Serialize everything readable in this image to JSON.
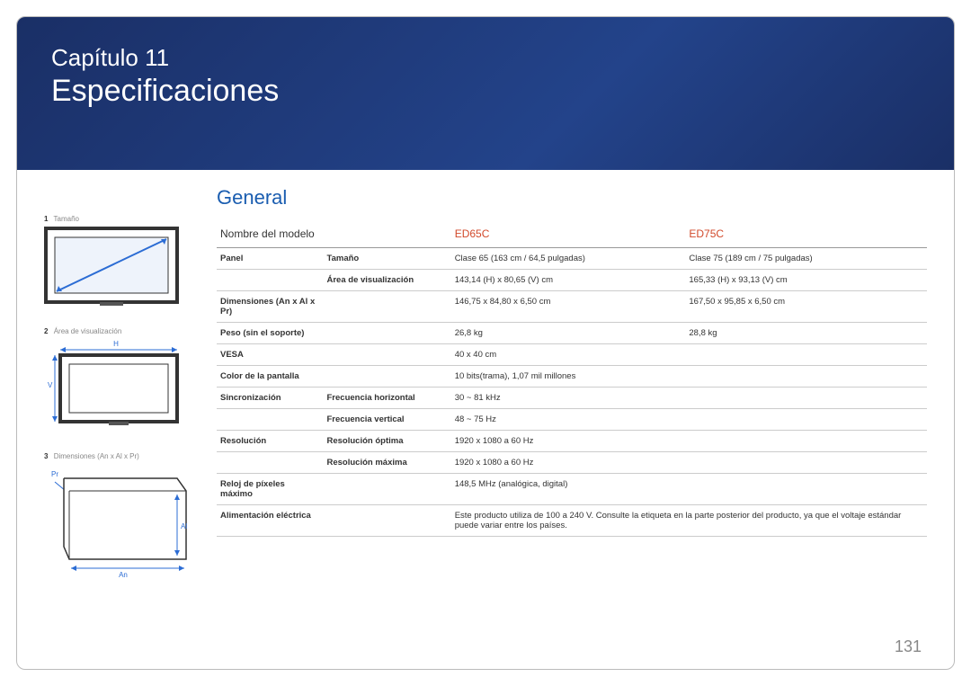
{
  "header": {
    "chapter": "Capítulo 11",
    "title": "Especificaciones"
  },
  "section_title": "General",
  "side_figures": {
    "fig1_num": "1",
    "fig1_label": "Tamaño",
    "fig2_num": "2",
    "fig2_label": "Área de visualización",
    "fig2_h": "H",
    "fig2_v": "V",
    "fig3_num": "3",
    "fig3_label": "Dimensiones (An x Al x Pr)",
    "fig3_pr": "Pr",
    "fig3_al": "Al",
    "fig3_an": "An"
  },
  "table": {
    "model_label": "Nombre del modelo",
    "model1": "ED65C",
    "model2": "ED75C",
    "rows": [
      {
        "cat": "Panel",
        "sub": "Tamaño",
        "v1": "Clase 65 (163 cm / 64,5 pulgadas)",
        "v2": "Clase 75 (189 cm / 75 pulgadas)"
      },
      {
        "cat": "",
        "sub": "Área de visualización",
        "v1": "143,14 (H) x 80,65 (V) cm",
        "v2": "165,33 (H) x 93,13 (V) cm"
      },
      {
        "cat": "Dimensiones (An x Al x Pr)",
        "sub": "",
        "v1": "146,75 x 84,80 x 6,50 cm",
        "v2": "167,50 x 95,85 x 6,50 cm"
      },
      {
        "cat": "Peso (sin el soporte)",
        "sub": "",
        "v1": "26,8 kg",
        "v2": "28,8 kg"
      },
      {
        "cat": "VESA",
        "sub": "",
        "v1": "40 x 40 cm",
        "v2": ""
      },
      {
        "cat": "Color de la pantalla",
        "sub": "",
        "v1": "10 bits(trama), 1,07 mil millones",
        "v2": ""
      },
      {
        "cat": "Sincronización",
        "sub": "Frecuencia horizontal",
        "v1": "30 ~ 81 kHz",
        "v2": ""
      },
      {
        "cat": "",
        "sub": "Frecuencia vertical",
        "v1": "48 ~ 75 Hz",
        "v2": ""
      },
      {
        "cat": "Resolución",
        "sub": "Resolución óptima",
        "v1": "1920 x 1080 a 60 Hz",
        "v2": ""
      },
      {
        "cat": "",
        "sub": "Resolución máxima",
        "v1": "1920 x 1080 a 60 Hz",
        "v2": ""
      },
      {
        "cat": "Reloj de píxeles máximo",
        "sub": "",
        "v1": "148,5 MHz (analógica, digital)",
        "v2": ""
      },
      {
        "cat": "Alimentación eléctrica",
        "sub": "",
        "v1": "Este producto utiliza de 100 a 240 V. Consulte la etiqueta en la parte posterior del producto, ya que el voltaje estándar puede variar entre los países.",
        "v2": ""
      }
    ]
  },
  "page_number": "131"
}
